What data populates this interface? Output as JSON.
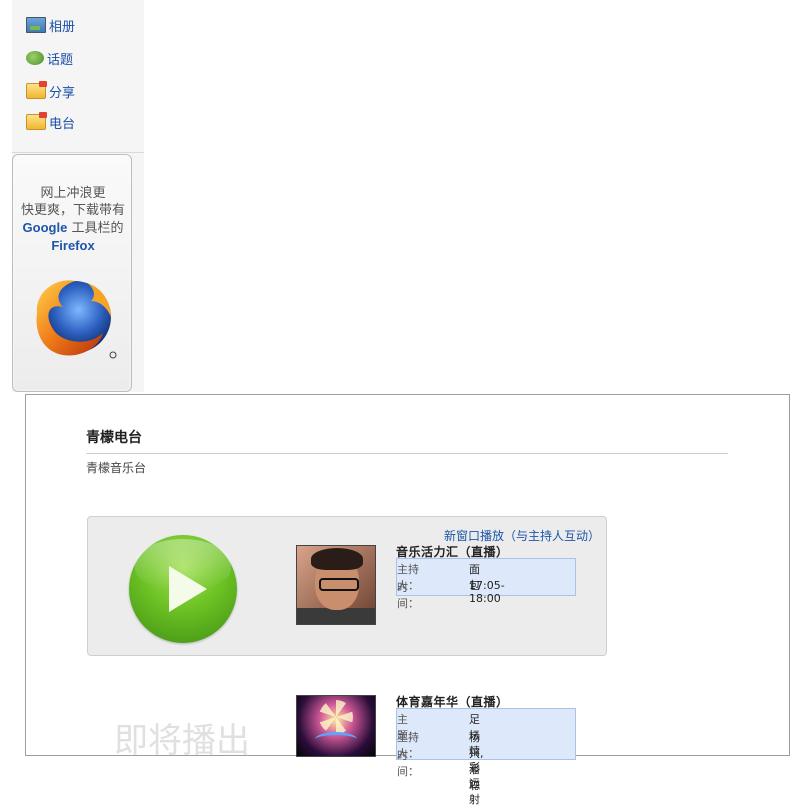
{
  "sidebar": {
    "items": [
      {
        "label": "相册",
        "icon": "album-icon"
      },
      {
        "label": "话题",
        "icon": "topic-icon"
      },
      {
        "label": "分享",
        "icon": "share-folder-icon"
      },
      {
        "label": "电台",
        "icon": "radio-folder-icon"
      }
    ],
    "promo": {
      "line1": "网上冲浪更",
      "line2": "快更爽，下载带有",
      "google": "Google",
      "line3_rest": " 工具栏的",
      "firefox": "Firefox"
    }
  },
  "main": {
    "title": "青檬电台",
    "subtitle": "青檬音乐台",
    "new_window_link": "新窗口播放（与主持人互动）",
    "now_playing": {
      "show": "音乐活力汇（直播）",
      "host_label": "主持人：",
      "host_value": "面包",
      "time_label": "时　间：",
      "time_value": "17:05-18:00"
    },
    "upcoming_label": "即将播出",
    "next_show": {
      "show": "体育嘉年华（直播）",
      "topic_label": "主　题：",
      "topic_value": "足坛精彩远射",
      "host_label": "主持人：",
      "host_value": "杨兴,潘聪",
      "time_label": "时　间："
    }
  },
  "colors": {
    "link": "#1d55a8",
    "play_green": "#6cc224",
    "info_bg": "#dde9fb"
  }
}
